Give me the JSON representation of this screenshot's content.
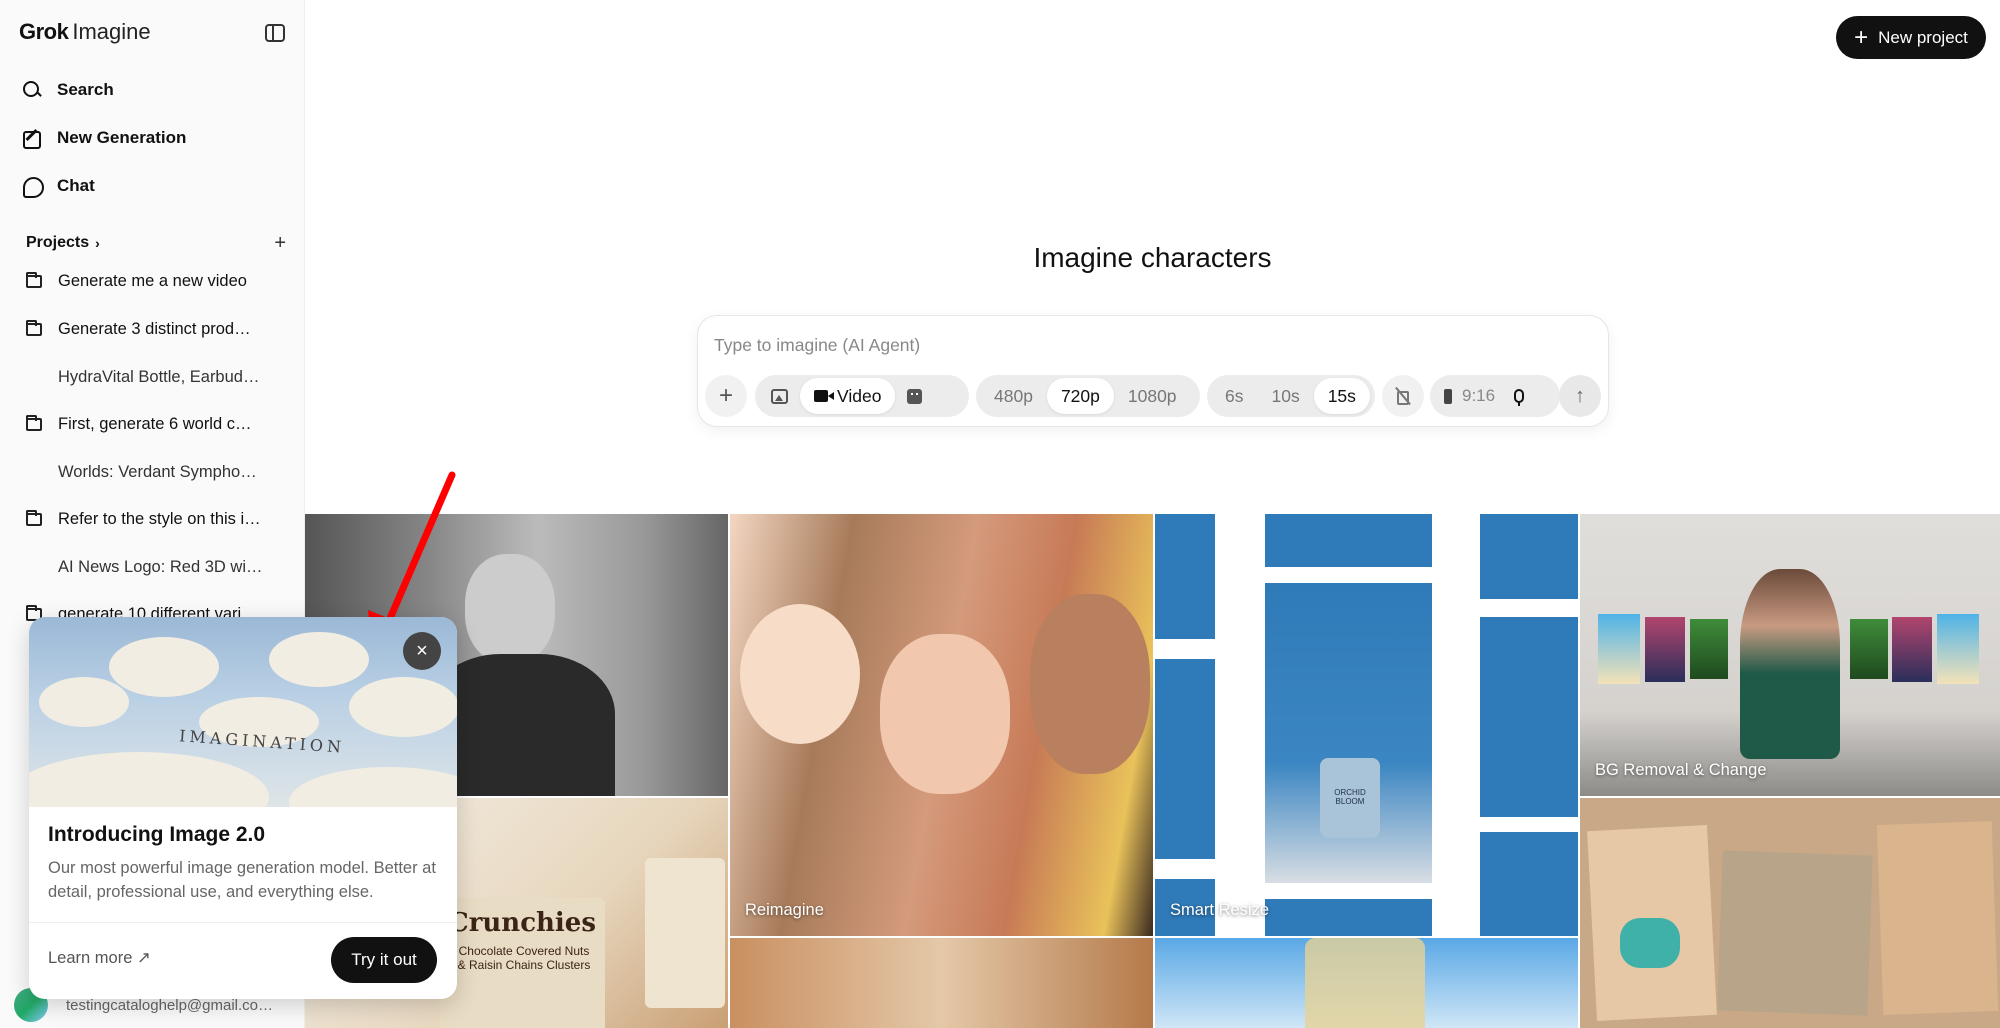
{
  "sidebar": {
    "brand_bold": "Grok",
    "brand_light": "Imagine",
    "nav": [
      {
        "label": "Search",
        "icon": "search-icon"
      },
      {
        "label": "New Generation",
        "icon": "edit-icon"
      },
      {
        "label": "Chat",
        "icon": "chat-icon"
      }
    ],
    "projects_label": "Projects",
    "projects": [
      {
        "label": "Generate me a new video",
        "child": false
      },
      {
        "label": "Generate 3 distinct prod…",
        "child": false
      },
      {
        "label": "HydraVital Bottle, Earbud…",
        "child": true
      },
      {
        "label": "First, generate 6 world c…",
        "child": false
      },
      {
        "label": "Worlds: Verdant Sympho…",
        "child": true
      },
      {
        "label": "Refer to the style on this i…",
        "child": false
      },
      {
        "label": "AI News Logo: Red 3D wi…",
        "child": true
      },
      {
        "label": "generate 10 different vari…",
        "child": false
      }
    ],
    "user_email": "testingcataloghelp@gmail.co…"
  },
  "header": {
    "new_project_label": "New project"
  },
  "main": {
    "headline": "Imagine characters",
    "prompt_placeholder": "Type to imagine (AI Agent)",
    "mode_video_label": "Video",
    "resolutions": [
      "480p",
      "720p",
      "1080p"
    ],
    "resolution_selected": "720p",
    "durations": [
      "6s",
      "10s",
      "15s"
    ],
    "duration_selected": "15s",
    "aspect_ratio": "9:16"
  },
  "gallery": {
    "labels": {
      "reimagine": "Reimagine",
      "smart_resize": "Smart Resize",
      "bg_removal": "BG Removal & Change"
    },
    "product_text": "Crunchies",
    "product_sub": "Chocolate Covered Nuts & Raisin Chains Clusters",
    "jar_text": "ORCHID BLOOM"
  },
  "popup": {
    "title": "Introducing Image 2.0",
    "body": "Our most powerful image generation model. Better at detail, professional use, and everything else.",
    "learn_more": "Learn more ↗",
    "cta": "Try it out",
    "hero_word": "IMAGINATION"
  },
  "colors": {
    "accent_dark": "#111111",
    "arrow_red": "#ff0000",
    "sky": "#9bb8d6"
  }
}
